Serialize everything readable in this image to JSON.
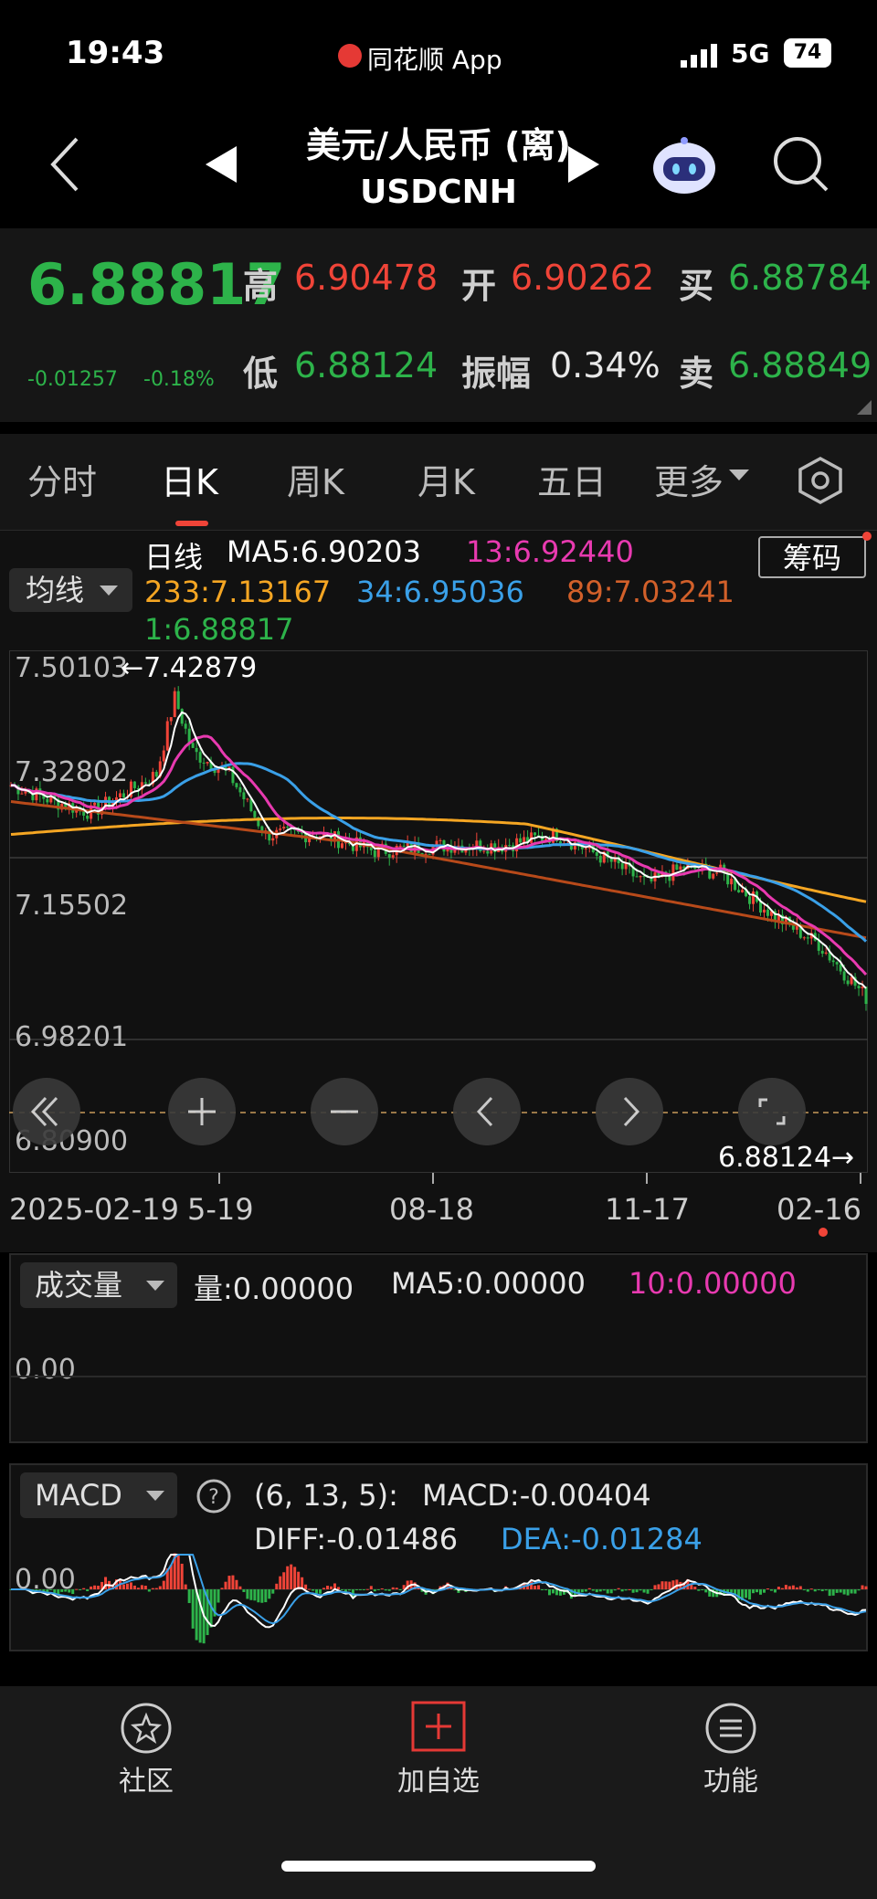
{
  "status_bar": {
    "time": "19:43",
    "app": "同花顺 App",
    "network": "5G",
    "battery": "74"
  },
  "header": {
    "title": "美元/人民币 (离)",
    "code": "USDCNH"
  },
  "quote": {
    "price": "6.88817",
    "change": "-0.01257",
    "change_pct": "-0.18%",
    "high_label": "高",
    "high": "6.90478",
    "open_label": "开",
    "open": "6.90262",
    "bid_label": "买",
    "bid": "6.88784",
    "low_label": "低",
    "low": "6.88124",
    "amp_label": "振幅",
    "amp": "0.34%",
    "ask_label": "卖",
    "ask": "6.88849"
  },
  "tabs": [
    "分时",
    "日K",
    "周K",
    "月K",
    "五日",
    "更多"
  ],
  "legend": {
    "ma_select": "均线",
    "period": "日线",
    "ma5": "MA5:6.90203",
    "ma13": "13:6.92440",
    "ma233": "233:7.13167",
    "ma34": "34:6.95036",
    "ma89": "89:7.03241",
    "ma1": "1:6.88817",
    "chips_button": "筹码"
  },
  "price_axis": [
    "7.50103",
    "7.32802",
    "7.15502",
    "6.98201",
    "6.80900"
  ],
  "max_marker": "←7.42879",
  "min_marker": "6.88124→",
  "date_axis": [
    "2025-02-19",
    "5-19",
    "08-18",
    "11-17",
    "02-16"
  ],
  "volume": {
    "select": "成交量",
    "vol": "量:0.00000",
    "ma5": "MA5:0.00000",
    "ma10": "10:0.00000",
    "axis": "0.00"
  },
  "macd": {
    "select": "MACD",
    "params": "(6, 13, 5):",
    "macd": "MACD:-0.00404",
    "diff": "DIFF:-0.01486",
    "dea": "DEA:-0.01284",
    "axis": "0.00"
  },
  "bottom_nav": [
    "社区",
    "加自选",
    "功能"
  ],
  "colors": {
    "up": "#f04438",
    "down": "#2db34a",
    "ma5": "#ffffff",
    "ma13": "#e83ab0",
    "ma34": "#3aa0e8",
    "ma89": "#b84a1a",
    "ma233": "#f5a623"
  }
}
